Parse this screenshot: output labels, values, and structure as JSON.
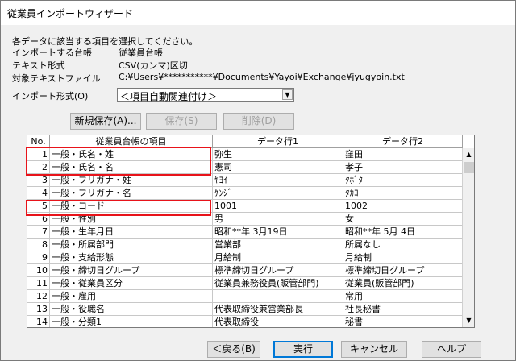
{
  "window": {
    "title": "従業員インポートウィザード"
  },
  "info": {
    "instruction": "各データに該当する項目を選択してください。",
    "import_ledger_label": "インポートする台帳",
    "import_ledger_value": "従業員台帳",
    "text_format_label": "テキスト形式",
    "text_format_value": "CSV(カンマ)区切",
    "target_file_label": "対象テキストファイル",
    "target_file_value": "C:¥Users¥***********¥Documents¥Yayoi¥Exchange¥jyugyoin.txt"
  },
  "import_format": {
    "label": "インポート形式(O)",
    "selected": "＜項目自動関連付け＞"
  },
  "toolbar": {
    "new_save": "新規保存(A)...",
    "save": "保存(S)",
    "delete": "削除(D)"
  },
  "table": {
    "headers": [
      "No.",
      "従業員台帳の項目",
      "データ行1",
      "データ行2"
    ],
    "rows": [
      {
        "no": "1",
        "item": "一般・氏名・姓",
        "d1": "弥生",
        "d2": "窪田"
      },
      {
        "no": "2",
        "item": "一般・氏名・名",
        "d1": "憲司",
        "d2": "孝子"
      },
      {
        "no": "3",
        "item": "一般・フリガナ・姓",
        "d1": "ﾔﾖｲ",
        "d2": "ｸﾎﾞﾀ"
      },
      {
        "no": "4",
        "item": "一般・フリガナ・名",
        "d1": "ｹﾝｼﾞ",
        "d2": "ﾀｶｺ"
      },
      {
        "no": "5",
        "item": "一般・コード",
        "d1": "1001",
        "d2": "1002"
      },
      {
        "no": "6",
        "item": "一般・性別",
        "d1": "男",
        "d2": "女"
      },
      {
        "no": "7",
        "item": "一般・生年月日",
        "d1": "昭和**年 3月19日",
        "d2": "昭和**年 5月 4日"
      },
      {
        "no": "8",
        "item": "一般・所属部門",
        "d1": "営業部",
        "d2": "所属なし"
      },
      {
        "no": "9",
        "item": "一般・支給形態",
        "d1": "月給制",
        "d2": "月給制"
      },
      {
        "no": "10",
        "item": "一般・締切日グループ",
        "d1": "標準締切日グループ",
        "d2": "標準締切日グループ"
      },
      {
        "no": "11",
        "item": "一般・従業員区分",
        "d1": "従業員兼務役員(販管部門)",
        "d2": "従業員(販管部門)"
      },
      {
        "no": "12",
        "item": "一般・雇用",
        "d1": "",
        "d2": "常用"
      },
      {
        "no": "13",
        "item": "一般・役職名",
        "d1": "代表取締役兼営業部長",
        "d2": "社長秘書"
      },
      {
        "no": "14",
        "item": "一般・分類1",
        "d1": "代表取締役",
        "d2": "秘書"
      }
    ]
  },
  "footer": {
    "back": "＜戻る(B)",
    "execute": "実行",
    "cancel": "キャンセル",
    "help": "ヘルプ"
  },
  "colors": {
    "highlight": "#e8131a",
    "dialog_bg": "#f0f0f0"
  }
}
